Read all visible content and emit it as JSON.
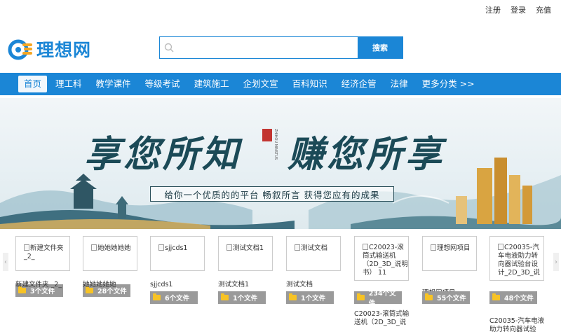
{
  "top_links": [
    "注册",
    "登录",
    "充值"
  ],
  "logo": {
    "text": "理想网"
  },
  "search": {
    "placeholder": "",
    "button_label": "搜索"
  },
  "nav": [
    {
      "label": "首页",
      "active": true
    },
    {
      "label": "理工科"
    },
    {
      "label": "教学课件"
    },
    {
      "label": "等级考试"
    },
    {
      "label": "建筑施工"
    },
    {
      "label": "企划文宣"
    },
    {
      "label": "百科知识"
    },
    {
      "label": "经济企管"
    },
    {
      "label": "法律"
    },
    {
      "label": "更多分类 >>"
    }
  ],
  "banner": {
    "slogan_left": "享您所知",
    "slogan_right": "赚您所享",
    "seal_sub": "ZHIHOU MINSTUS",
    "tagline": "给你一个优质的的平台 畅叙所言 获得您应有的成果"
  },
  "colors": {
    "brand": "#1b86d6",
    "badge": "#9a9a9a",
    "folder": "#f7c325"
  },
  "file_cards": [
    {
      "thumb_alt": "新建文件夹 _2_",
      "name": "新建文件夹 _2_",
      "count": "3个文件"
    },
    {
      "thumb_alt": "她她她她她",
      "name": "她她她她她",
      "count": "28个文件"
    },
    {
      "thumb_alt": "sjjcds1",
      "name": "sjjcds1",
      "count": "6个文件"
    },
    {
      "thumb_alt": "测试文档1",
      "name": "测试文档1",
      "count": "1个文件"
    },
    {
      "thumb_alt": "测试文档",
      "name": "测试文档",
      "count": "1个文件"
    },
    {
      "thumb_alt": "C20023-滚筒式输送机 （2D_3D_说明书） 11",
      "name": "C20023-滚筒式输送机（2D_3D_说",
      "count": "234个文件"
    },
    {
      "thumb_alt": "理想网项目",
      "name": "理想网项目",
      "count": "55个文件"
    },
    {
      "thumb_alt": "C20035-汽车电液助力转向器试验台设计_2D_3D_说",
      "name": "C20035-汽车电液助力转向器试验",
      "count": "48个文件"
    }
  ]
}
